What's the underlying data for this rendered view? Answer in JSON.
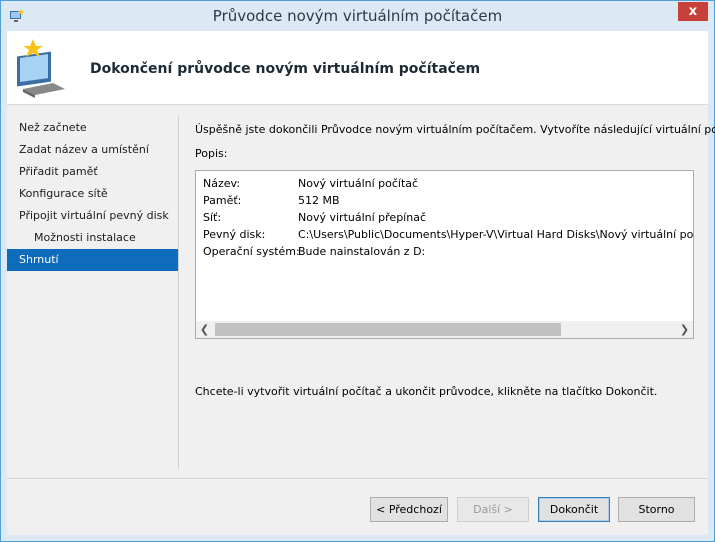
{
  "window": {
    "title": "Průvodce novým virtuálním počítačem",
    "close_glyph": "x"
  },
  "header": {
    "title": "Dokončení průvodce novým virtuálním počítačem",
    "icon": "new-virtual-machine-icon"
  },
  "nav": {
    "items": [
      {
        "label": "Než začnete",
        "indent": false,
        "active": false
      },
      {
        "label": "Zadat název a umístění",
        "indent": false,
        "active": false
      },
      {
        "label": "Přiřadit paměť",
        "indent": false,
        "active": false
      },
      {
        "label": "Konfigurace sítě",
        "indent": false,
        "active": false
      },
      {
        "label": "Připojit virtuální pevný disk",
        "indent": false,
        "active": false
      },
      {
        "label": "Možnosti instalace",
        "indent": true,
        "active": false
      },
      {
        "label": "Shrnutí",
        "indent": false,
        "active": true
      }
    ]
  },
  "main": {
    "intro": "Úspěšně jste dokončili Průvodce novým virtuálním počítačem. Vytvoříte následující virtuální počítač.",
    "description_label": "Popis:",
    "summary": [
      {
        "key": "Název:",
        "value": "Nový virtuální počítač"
      },
      {
        "key": "Paměť:",
        "value": "512 MB"
      },
      {
        "key": "Síť:",
        "value": "Nový virtuální přepínač"
      },
      {
        "key": "Pevný disk:",
        "value": "C:\\Users\\Public\\Documents\\Hyper-V\\Virtual Hard Disks\\Nový virtuální počítač.vhdx"
      },
      {
        "key": "Operační systém:",
        "value": "Bude nainstalován z D:"
      }
    ],
    "footer_text": "Chcete-li vytvořit virtuální počítač a ukončit průvodce, klikněte na tlačítko Dokončit."
  },
  "buttons": {
    "previous": "< Předchozí",
    "next": "Další >",
    "finish": "Dokončit",
    "cancel": "Storno"
  },
  "colors": {
    "accent": "#0f6cbd",
    "close": "#c8403a",
    "frame": "#dce9f5"
  }
}
